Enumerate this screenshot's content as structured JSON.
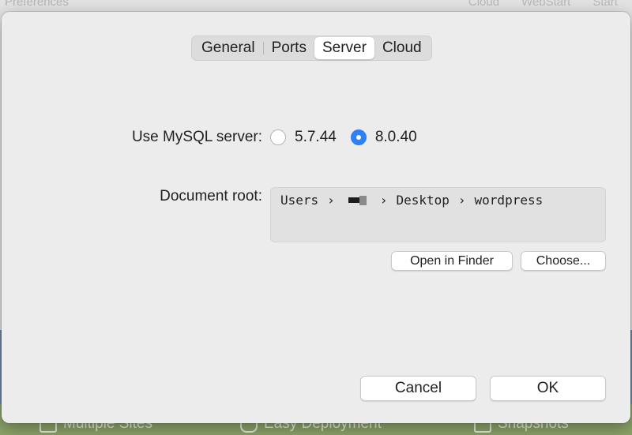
{
  "background": {
    "window_title": "Preferences",
    "tabs": [
      "Cloud",
      "WebStart",
      "Start"
    ],
    "features": [
      "Multiple Sites",
      "Easy Deployment",
      "Snapshots"
    ]
  },
  "tabs": [
    {
      "label": "General",
      "selected": false
    },
    {
      "label": "Ports",
      "selected": false
    },
    {
      "label": "Server",
      "selected": true
    },
    {
      "label": "Cloud",
      "selected": false
    }
  ],
  "mysql": {
    "label": "Use MySQL server:",
    "options": [
      {
        "label": "5.7.44",
        "selected": false
      },
      {
        "label": "8.0.40",
        "selected": true
      }
    ]
  },
  "document_root": {
    "label": "Document root:",
    "path": [
      "Users",
      "Desktop",
      "wordpress"
    ],
    "separator": "›"
  },
  "buttons": {
    "open_in_finder": "Open in Finder",
    "choose": "Choose...",
    "cancel": "Cancel",
    "ok": "OK"
  },
  "colors": {
    "accent": "#2f7ff6",
    "sheet_background": "#ececec"
  }
}
